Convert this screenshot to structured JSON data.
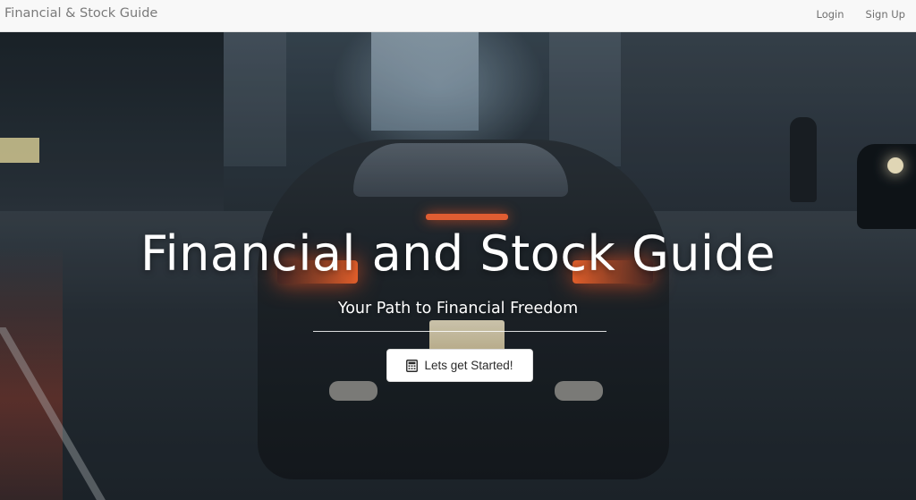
{
  "navbar": {
    "brand": "Financial & Stock Guide",
    "links": [
      {
        "label": "Login"
      },
      {
        "label": "Sign Up"
      }
    ]
  },
  "hero": {
    "title": "Financial and Stock Guide",
    "subtitle": "Your Path to Financial Freedom",
    "cta": {
      "label": "Lets get Started!",
      "icon": "calculator-icon"
    },
    "background_image": "car-on-wet-city-street"
  }
}
